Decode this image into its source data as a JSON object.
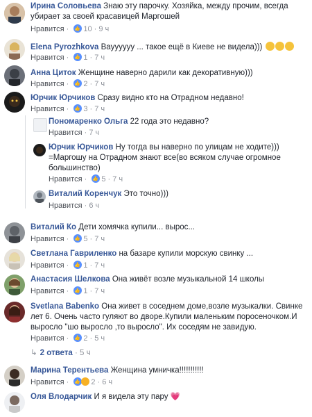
{
  "comments": [
    {
      "name": "Ирина Соловьева",
      "text": "Знаю эту парочку. Хозяйка, между прочим, всегда убирает за своей красавицей Маргошей",
      "like": "Нравится",
      "reactions": "10",
      "time": "9 ч"
    },
    {
      "name": "Elena Pyrozhkova",
      "text": "Вауууууу ... такое ещё в Киеве не видела)))",
      "like": "Нравится",
      "reactions": "1",
      "time": "7 ч"
    },
    {
      "name": "Анна Циток",
      "text": "Женщине наверно дарили как декоративную)))",
      "like": "Нравится",
      "reactions": "2",
      "time": "7 ч"
    },
    {
      "name": "Юрчик Юрчиков",
      "text": "Сразу видно кто на Отрадном недавно!",
      "like": "Нравится",
      "reactions": "3",
      "time": "7 ч"
    }
  ],
  "replies": [
    {
      "name": "Пономаренко Ольга",
      "text": "22 года это недавно?",
      "like": "Нравится",
      "time": "7 ч"
    },
    {
      "name": "Юрчик Юрчиков",
      "text": "Ну тогда вы наверно по улицам не ходите))) =Маргошу на Отрадном знают все(во всяком случае огромное большинство)",
      "like": "Нравится",
      "reactions": "5",
      "time": "7 ч"
    },
    {
      "name": "Виталий Коренчук",
      "text": "Это точно)))",
      "like": "Нравится",
      "time": "6 ч"
    }
  ],
  "comments2": [
    {
      "name": "Виталий Ко",
      "text": "Дети хомячка купили... вырос...",
      "like": "Нравится",
      "reactions": "5",
      "time": "7 ч"
    },
    {
      "name": "Светлана Гавриленко",
      "text": "на базаре купили морскую свинку ...",
      "like": "Нравится",
      "reactions": "1",
      "time": "7 ч"
    },
    {
      "name": "Анастасия Шелкова",
      "text": "Она живёт возле музыкальной 14 школы",
      "like": "Нравится",
      "reactions": "1",
      "time": "7 ч"
    },
    {
      "name": "Svetlana Babenko",
      "text": "Она живет в соседнем доме,возле музыкалки. Свинке лет 6. Очень часто гуляют во дворе.Купили маленьким поросеночком.И выросло \"шо выросло ,то выросло\". Их соседям не завидую.",
      "like": "Нравится",
      "reactions": "2",
      "time": "5 ч"
    }
  ],
  "replies_link": "2 ответа",
  "replies_time": "5 ч",
  "comments3": [
    {
      "name": "Марина Терентьева",
      "text": "Женщина умничка!!!!!!!!!!!",
      "like": "Нравится",
      "reactions": "2",
      "time": "6 ч"
    },
    {
      "name": "Оля Влодарчик",
      "text": "И я видела эту пару"
    }
  ],
  "colors": {
    "link": "#385898",
    "meta": "#90949c",
    "like_reaction": "#5890ff"
  }
}
